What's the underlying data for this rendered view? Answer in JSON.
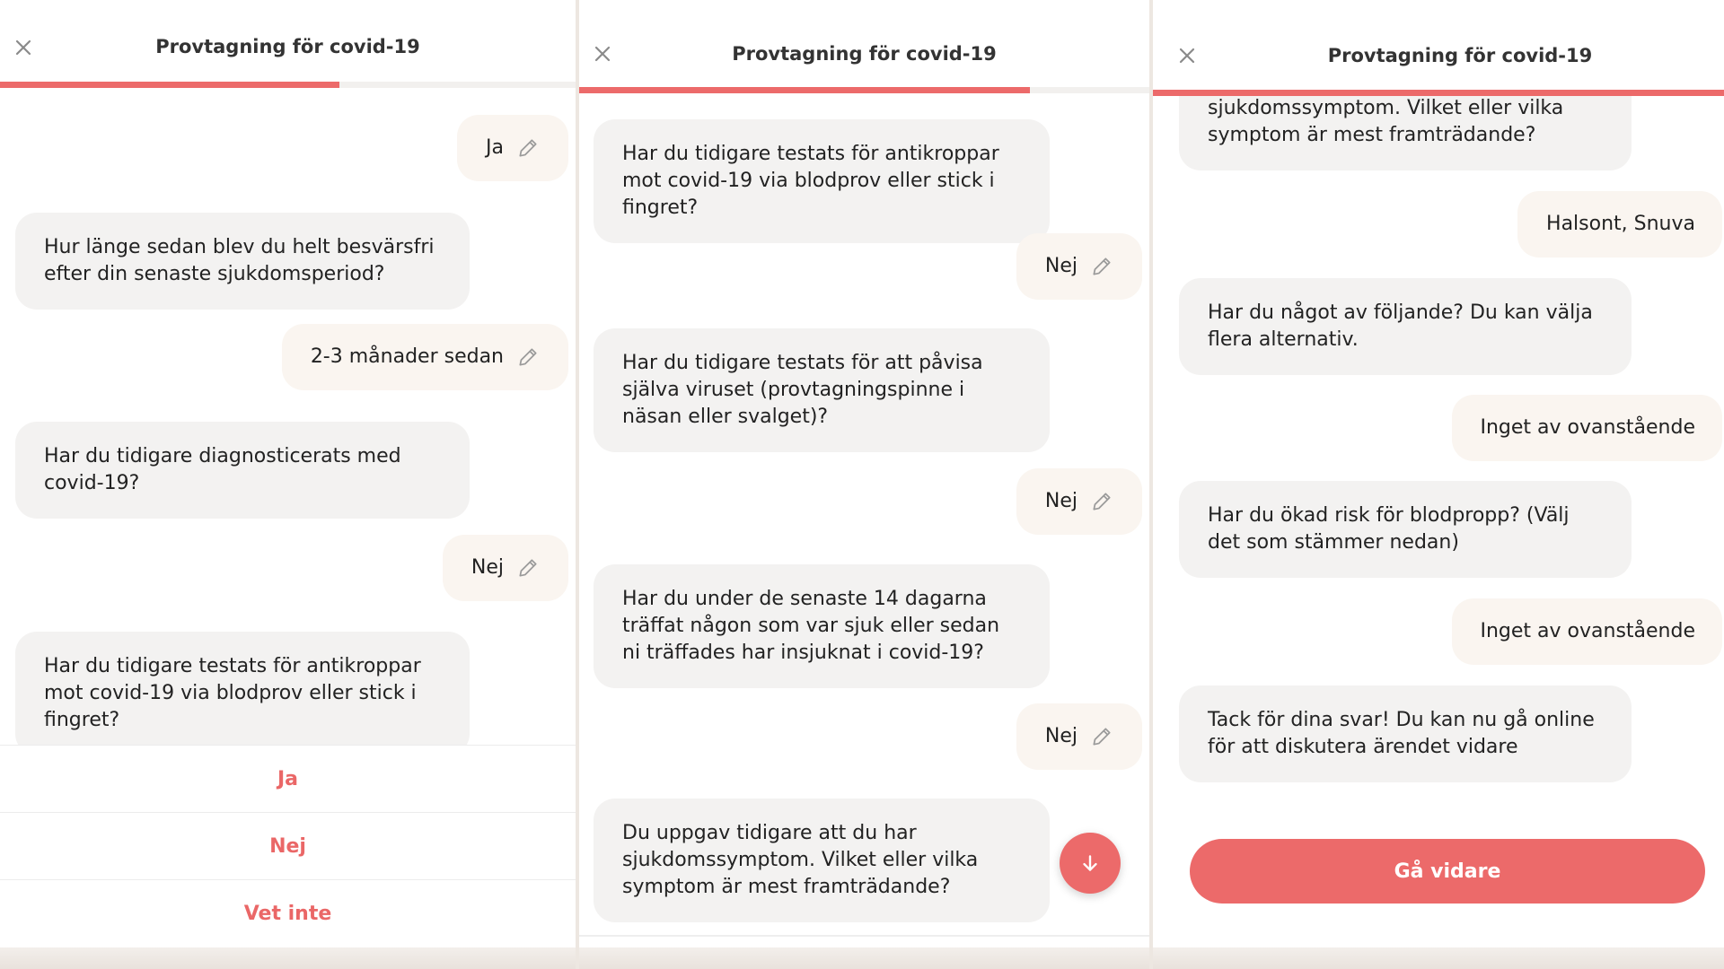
{
  "colors": {
    "accent": "#ec6a6a",
    "bot_bubble": "#f3f2f1",
    "user_bubble": "#faf5f0",
    "page_bg": "#ede7e1"
  },
  "panels": [
    {
      "title": "Provtagning för covid-19",
      "progress_fraction": 0.59,
      "messages": [
        {
          "from": "user",
          "text": "Ja"
        },
        {
          "from": "bot",
          "text": "Hur länge sedan blev du helt besvärsfri efter din senaste sjukdomsperiod?"
        },
        {
          "from": "user",
          "text": "2-3 månader sedan"
        },
        {
          "from": "bot",
          "text": "Har du tidigare diagnosticerats med covid-19?"
        },
        {
          "from": "user",
          "text": "Nej"
        },
        {
          "from": "bot",
          "text": "Har du tidigare testats för antikroppar mot covid-19 via blodprov eller stick i fingret?"
        }
      ],
      "options": [
        "Ja",
        "Nej",
        "Vet inte"
      ]
    },
    {
      "title": "Provtagning för covid-19",
      "progress_fraction": 0.79,
      "messages": [
        {
          "from": "bot",
          "text": "Har du tidigare testats för antikroppar mot covid-19 via blodprov eller stick i fingret?"
        },
        {
          "from": "user",
          "text": "Nej"
        },
        {
          "from": "bot",
          "text": "Har du tidigare testats för att påvisa själva viruset (provtagningspinne i näsan eller svalget)?"
        },
        {
          "from": "user",
          "text": "Nej"
        },
        {
          "from": "bot",
          "text": "Har du under de senaste 14 dagarna träffat någon som var sjuk eller sedan ni träffades har insjuknat i covid-19?"
        },
        {
          "from": "user",
          "text": "Nej"
        },
        {
          "from": "bot",
          "text": "Du uppgav tidigare att du har sjukdomssymptom. Vilket eller vilka symptom är mest framträdande?"
        }
      ],
      "scroll_icon": "arrow-down-icon"
    },
    {
      "title": "Provtagning för covid-19",
      "progress_fraction": 1.0,
      "messages": [
        {
          "from": "bot",
          "text": "sjukdomssymptom. Vilket eller vilka symptom är mest framträdande?"
        },
        {
          "from": "user",
          "text": "Halsont, Snuva"
        },
        {
          "from": "bot",
          "text": "Har du något av följande? Du kan välja flera alternativ."
        },
        {
          "from": "user",
          "text": "Inget av ovanstående"
        },
        {
          "from": "bot",
          "text": "Har du ökad risk för blodpropp? (Välj det som stämmer nedan)"
        },
        {
          "from": "user",
          "text": "Inget av ovanstående"
        },
        {
          "from": "bot",
          "text": "Tack för dina svar! Du kan nu gå online för att diskutera ärendet vidare"
        }
      ],
      "cta_label": "Gå vidare"
    }
  ]
}
